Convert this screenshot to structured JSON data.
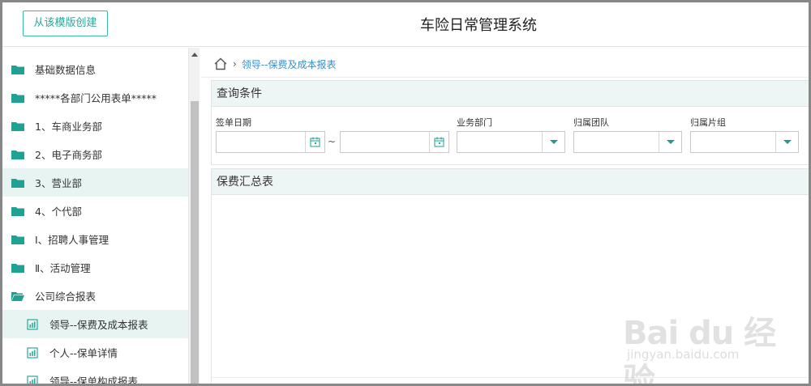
{
  "header": {
    "create_button": "从该模版创建",
    "title": "车险日常管理系统"
  },
  "sidebar": {
    "items": [
      {
        "label": "基础数据信息",
        "icon": "folder-icon",
        "active": false
      },
      {
        "label": "*****各部门公用表单*****",
        "icon": "folder-icon",
        "active": false
      },
      {
        "label": "1、车商业务部",
        "icon": "folder-icon",
        "active": false
      },
      {
        "label": "2、电子商务部",
        "icon": "folder-icon",
        "active": false
      },
      {
        "label": "3、营业部",
        "icon": "folder-icon",
        "active": true
      },
      {
        "label": "4、个代部",
        "icon": "folder-icon",
        "active": false
      },
      {
        "label": "Ⅰ、招聘人事管理",
        "icon": "folder-icon",
        "active": false
      },
      {
        "label": "Ⅱ、活动管理",
        "icon": "folder-icon",
        "active": false
      },
      {
        "label": "公司综合报表",
        "icon": "folder-open-icon",
        "active": false
      },
      {
        "label": "领导--保费及成本报表",
        "icon": "report-icon",
        "active": true
      },
      {
        "label": "个人--保单详情",
        "icon": "report-icon",
        "active": false
      },
      {
        "label": "领导--保单构成报表",
        "icon": "report-icon",
        "active": false
      }
    ]
  },
  "breadcrumb": {
    "current": "领导--保费及成本报表"
  },
  "query": {
    "title": "查询条件",
    "date_label": "签单日期",
    "date_separator": "~",
    "dept_label": "业务部门",
    "team_label": "归属团队",
    "group_label": "归属片组"
  },
  "summary": {
    "title": "保费汇总表"
  },
  "watermark": {
    "logo": "Bai du 经验",
    "url": "jingyan.baidu.com"
  },
  "colors": {
    "accent": "#2aa89a",
    "active_bg": "#e7f4f2",
    "panel_head": "#eef6f5",
    "link": "#3a8ec7"
  }
}
